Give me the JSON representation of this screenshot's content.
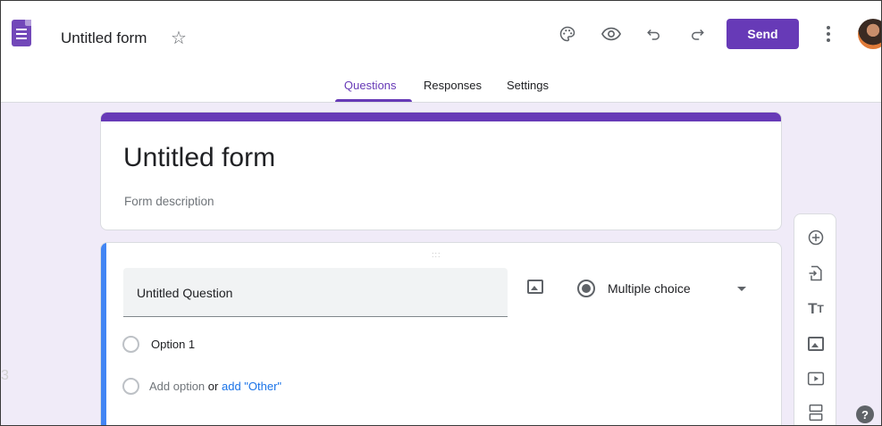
{
  "header": {
    "doc_title": "Untitled form",
    "send_label": "Send"
  },
  "tabs": [
    {
      "label": "Questions",
      "active": true
    },
    {
      "label": "Responses",
      "active": false
    },
    {
      "label": "Settings",
      "active": false
    }
  ],
  "form": {
    "title": "Untitled form",
    "description_placeholder": "Form description"
  },
  "question": {
    "title": "Untitled Question",
    "type": "Multiple choice",
    "options": [
      "Option 1"
    ],
    "add_option": "Add option",
    "or": "or",
    "add_other": "add \"Other\""
  },
  "colors": {
    "accent": "#673ab7",
    "active_card": "#4285f4",
    "background": "#f0ebf8"
  },
  "icons": {
    "header": [
      "palette-icon",
      "preview-eye-icon",
      "undo-icon",
      "redo-icon",
      "more-vert-icon"
    ],
    "side_toolbar": [
      "add-question-icon",
      "import-questions-icon",
      "add-title-icon",
      "add-image-icon",
      "add-video-icon",
      "add-section-icon"
    ]
  },
  "edge_glyph": "3"
}
